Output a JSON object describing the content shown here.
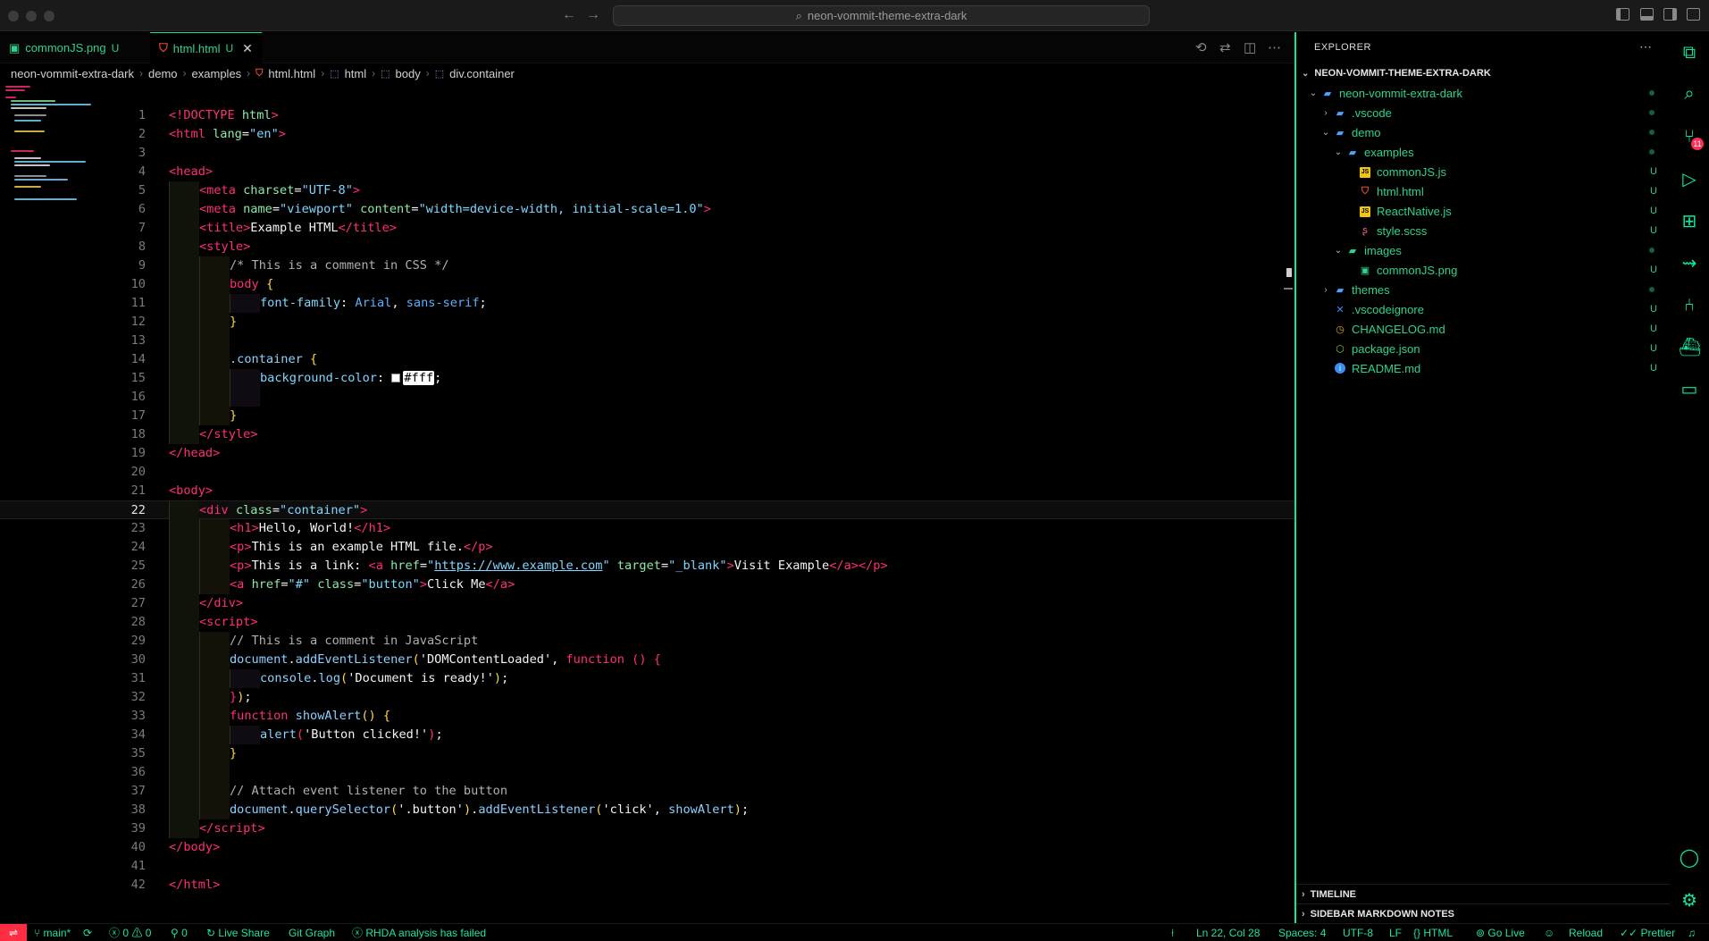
{
  "window": {
    "search_text": "neon-vommit-theme-extra-dark"
  },
  "tabs": [
    {
      "label": "commonJS.png",
      "status": "U"
    },
    {
      "label": "html.html",
      "status": "U"
    }
  ],
  "breadcrumb": [
    "neon-vommit-extra-dark",
    "demo",
    "examples",
    "html.html",
    "html",
    "body",
    "div.container"
  ],
  "editor": {
    "current_line": 22
  },
  "sidebar": {
    "title": "EXPLORER",
    "root": "NEON-VOMMIT-THEME-EXTRA-DARK",
    "items": [
      {
        "name": "neon-vommit-extra-dark",
        "badge": ""
      },
      {
        "name": ".vscode",
        "badge": ""
      },
      {
        "name": "demo",
        "badge": ""
      },
      {
        "name": "examples",
        "badge": ""
      },
      {
        "name": "commonJS.js",
        "badge": "U"
      },
      {
        "name": "html.html",
        "badge": "U"
      },
      {
        "name": "ReactNative.js",
        "badge": "U"
      },
      {
        "name": "style.scss",
        "badge": "U"
      },
      {
        "name": "images",
        "badge": ""
      },
      {
        "name": "commonJS.png",
        "badge": "U"
      },
      {
        "name": "themes",
        "badge": ""
      },
      {
        "name": ".vscodeignore",
        "badge": "U"
      },
      {
        "name": "CHANGELOG.md",
        "badge": "U"
      },
      {
        "name": "package.json",
        "badge": "U"
      },
      {
        "name": "README.md",
        "badge": "U"
      }
    ],
    "timeline": "TIMELINE",
    "markdown_notes": "SIDEBAR MARKDOWN NOTES"
  },
  "activity": {
    "scm_badge": "11"
  },
  "statusbar": {
    "branch": "main*",
    "errors": "0",
    "warnings": "0",
    "ports": "0",
    "live_share": "Live Share",
    "git_graph": "Git Graph",
    "rhda": "RHDA analysis has failed",
    "position": "Ln 22, Col 28",
    "spaces": "Spaces: 4",
    "encoding": "UTF-8",
    "eol": "LF",
    "language": "HTML",
    "go_live": "Go Live",
    "reload": "Reload",
    "prettier": "Prettier"
  },
  "colors": {
    "accent": "#0ee6a0",
    "tag": "#ff2d7a",
    "string": "#7fd7ff",
    "git_untracked": "#2ed38c",
    "error": "#ff2d44"
  }
}
